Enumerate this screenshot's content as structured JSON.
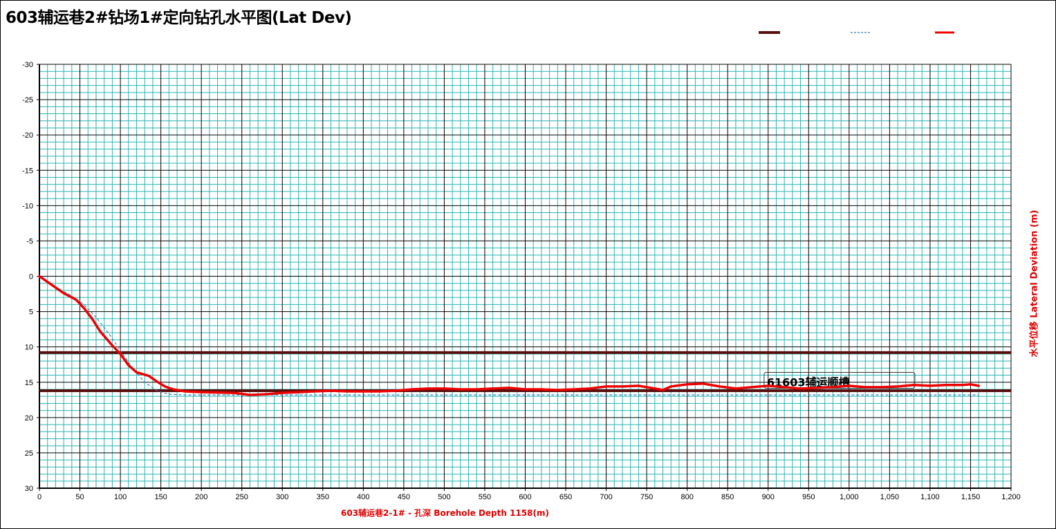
{
  "chart_data": {
    "type": "line",
    "title": "603辅运巷2#钻场1#定向钻孔水平图(Lat Dev)",
    "xlabel": "603辅运巷2-1# - 孔深   Borehole Depth 1158(m)",
    "ylabel": "水平位移     Lateral Deviation  (m)",
    "xlim": [
      0,
      1200
    ],
    "ylim": [
      -30,
      30
    ],
    "y_inverted": true,
    "x_ticks": [
      "0",
      "50",
      "100",
      "150",
      "200",
      "250",
      "300",
      "350",
      "400",
      "450",
      "500",
      "550",
      "600",
      "650",
      "700",
      "750",
      "800",
      "850",
      "900",
      "950",
      "1,000",
      "1,050",
      "1,100",
      "1,150",
      "1,200"
    ],
    "y_ticks": [
      "-30",
      "-25",
      "-20",
      "-15",
      "-10",
      "-5",
      "0",
      "5",
      "10",
      "15",
      "20",
      "25",
      "30"
    ],
    "grid": true,
    "legend_position": "top-right",
    "annotation": "61603辅运顺槽",
    "colors": {
      "actual": "#ee0000",
      "design": "#3a7fb8",
      "boundary": "#5a0f0f",
      "grid_minor": "#28b4b4",
      "grid_major": "#000000"
    },
    "series": [
      {
        "name": "",
        "style": "dashed",
        "x": [
          0,
          20,
          40,
          55,
          70,
          85,
          100,
          115,
          130,
          145,
          160,
          180,
          200,
          300,
          400,
          500,
          600,
          700,
          800,
          900,
          1000,
          1100,
          1160
        ],
        "y": [
          0,
          1.5,
          2.8,
          4.0,
          5.8,
          8.0,
          10.5,
          13.0,
          15.0,
          16.2,
          16.7,
          16.8,
          16.8,
          16.8,
          16.8,
          16.8,
          16.8,
          16.8,
          16.8,
          16.8,
          16.8,
          16.8,
          16.8
        ]
      },
      {
        "name": "",
        "style": "solid",
        "x": [
          0,
          15,
          30,
          45,
          55,
          65,
          75,
          90,
          100,
          110,
          120,
          135,
          145,
          155,
          165,
          180,
          200,
          240,
          260,
          280,
          300,
          320,
          340,
          360,
          380,
          400,
          420,
          440,
          460,
          480,
          500,
          520,
          540,
          560,
          580,
          600,
          620,
          640,
          660,
          680,
          700,
          720,
          740,
          760,
          770,
          780,
          800,
          820,
          840,
          860,
          880,
          900,
          920,
          940,
          960,
          980,
          1000,
          1020,
          1040,
          1060,
          1080,
          1100,
          1120,
          1140,
          1150,
          1160
        ],
        "y": [
          0,
          1.2,
          2.4,
          3.3,
          4.5,
          6.0,
          7.8,
          9.8,
          11.0,
          12.6,
          13.6,
          14.1,
          14.9,
          15.6,
          16.0,
          16.3,
          16.4,
          16.5,
          16.8,
          16.7,
          16.5,
          16.4,
          16.3,
          16.2,
          16.3,
          16.3,
          16.3,
          16.2,
          16.0,
          15.9,
          15.9,
          16.0,
          16.0,
          15.9,
          15.8,
          16.0,
          16.0,
          16.1,
          16.0,
          15.9,
          15.6,
          15.6,
          15.5,
          15.9,
          16.1,
          15.6,
          15.3,
          15.2,
          15.6,
          15.9,
          15.7,
          15.5,
          15.7,
          15.9,
          15.8,
          15.7,
          15.5,
          15.7,
          15.7,
          15.6,
          15.4,
          15.5,
          15.4,
          15.4,
          15.3,
          15.5
        ]
      }
    ],
    "boundaries": [
      {
        "name": "",
        "y": 10.8
      },
      {
        "name": "",
        "y": 16.2
      }
    ]
  }
}
